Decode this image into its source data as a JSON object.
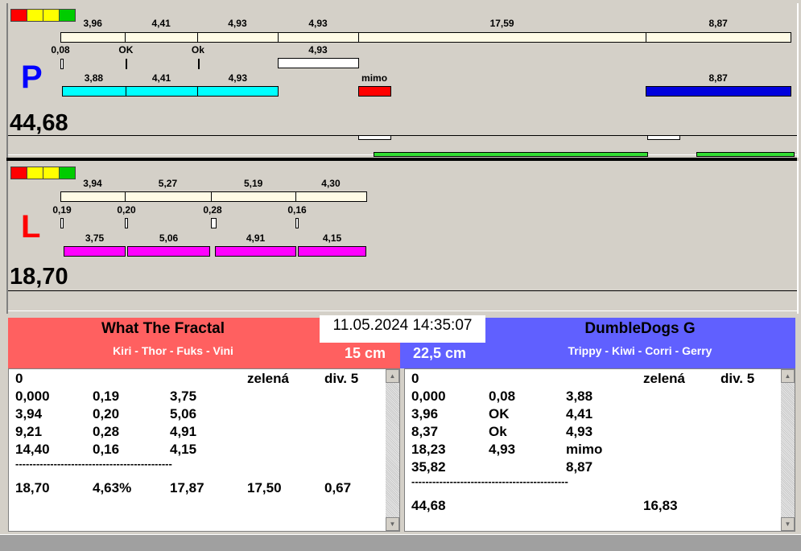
{
  "indicator_colors": [
    "#ff0000",
    "#ffff00",
    "#ffff00",
    "#00cc00"
  ],
  "right": {
    "side": "P",
    "total": "44,68",
    "top": [
      "3,96",
      "4,41",
      "4,93",
      "4,93",
      "17,59",
      "8,87"
    ],
    "top_values": [
      3.96,
      4.41,
      4.93,
      4.93,
      17.59,
      8.87
    ],
    "marks": [
      "0,08",
      "OK",
      "Ok"
    ],
    "white_label": "4,93",
    "run": [
      "3,88",
      "4,41",
      "4,93"
    ],
    "run_values": [
      3.88,
      4.41,
      4.93
    ],
    "mimo": "mimo",
    "blue_label": "8,87"
  },
  "left": {
    "side": "L",
    "total": "18,70",
    "top": [
      "3,94",
      "5,27",
      "5,19",
      "4,30"
    ],
    "top_values": [
      3.94,
      5.27,
      5.19,
      4.3
    ],
    "marks": [
      "0,19",
      "0,20",
      "0,28",
      "0,16"
    ],
    "run": [
      "3,75",
      "5,06",
      "4,91",
      "4,15"
    ]
  },
  "datetime": "11.05.2024 14:35:07",
  "team_left": {
    "name": "What The Fractal",
    "dogs": "Kiri - Thor - Fuks - Vini",
    "height": "15 cm",
    "color": "#ff6060",
    "rows": [
      [
        "0",
        "",
        "",
        "zelená",
        "div. 5"
      ],
      [
        "0,000",
        "0,19",
        "3,75",
        "",
        ""
      ],
      [
        "3,94",
        "0,20",
        "5,06",
        "",
        ""
      ],
      [
        "9,21",
        "0,28",
        "4,91",
        "",
        ""
      ],
      [
        "14,40",
        "0,16",
        "4,15",
        "",
        ""
      ],
      [
        "---------------------------------------------",
        "",
        "",
        "",
        ""
      ],
      [
        "18,70",
        "4,63%",
        "17,87",
        "17,50",
        "0,67"
      ]
    ]
  },
  "team_right": {
    "name": "DumbleDogs G",
    "dogs": "Trippy - Kiwi - Corri - Gerry",
    "height": "22,5 cm",
    "color": "#6060ff",
    "rows": [
      [
        "0",
        "",
        "",
        "zelená",
        "div. 5"
      ],
      [
        "0,000",
        "0,08",
        "3,88",
        "",
        ""
      ],
      [
        "3,96",
        "OK",
        "4,41",
        "",
        ""
      ],
      [
        "8,37",
        "Ok",
        "4,93",
        "",
        ""
      ],
      [
        "18,23",
        "4,93",
        "mimo",
        "",
        ""
      ],
      [
        "35,82",
        "",
        "8,87",
        "",
        ""
      ],
      [
        "---------------------------------------------",
        "",
        "",
        "",
        ""
      ],
      [
        "44,68",
        "",
        "",
        "16,83",
        ""
      ]
    ]
  }
}
